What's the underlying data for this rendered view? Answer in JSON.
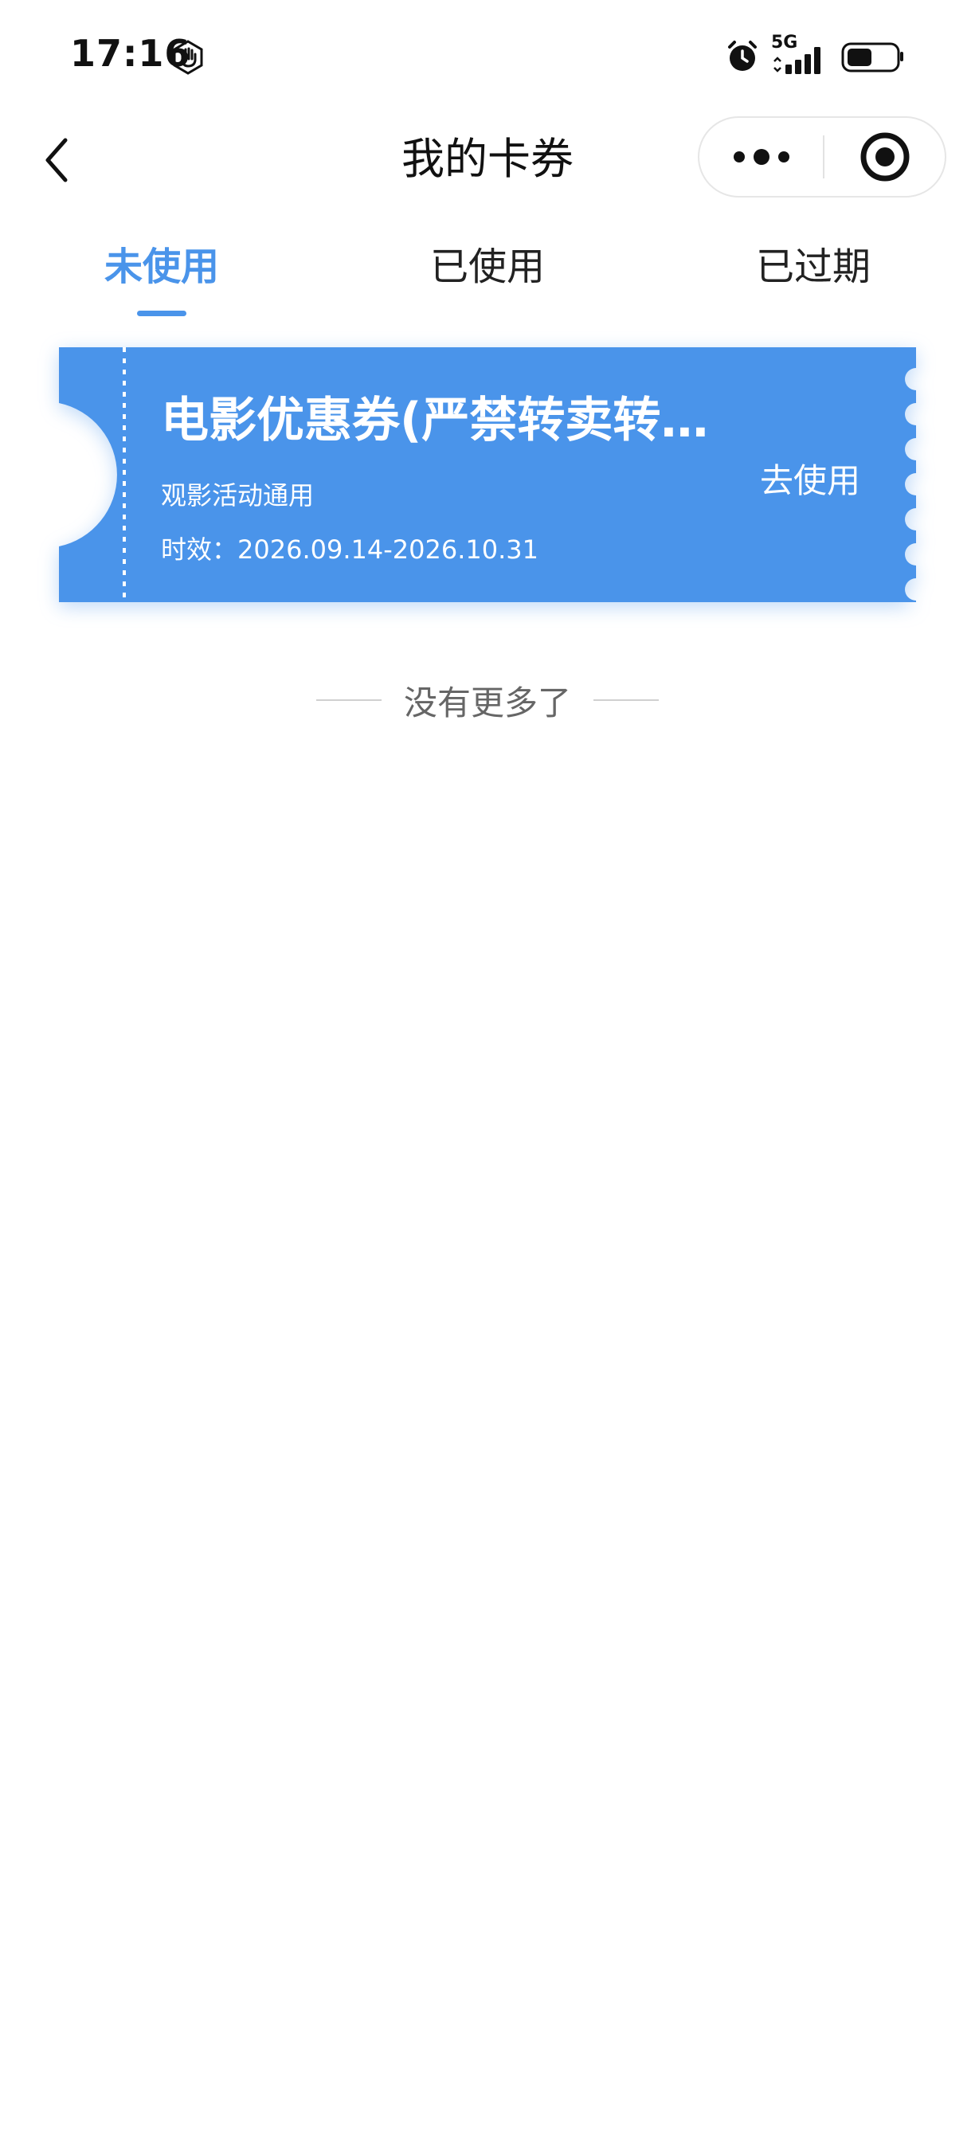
{
  "status_bar": {
    "time": "17:16",
    "network": "5G",
    "icons": [
      "hand-stop-icon",
      "alarm-icon",
      "signal-icon",
      "battery-icon"
    ]
  },
  "nav": {
    "title": "我的卡券",
    "icons": [
      "back-arrow-icon",
      "more-dots-icon",
      "target-close-icon"
    ]
  },
  "tabs": [
    {
      "label": "未使用",
      "active": true
    },
    {
      "label": "已使用",
      "active": false
    },
    {
      "label": "已过期",
      "active": false
    }
  ],
  "coupons": [
    {
      "title": "电影优惠券(严禁转卖转…",
      "subtitle": "观影活动通用",
      "validity": "时效：2026.09.14-2026.10.31",
      "action": "去使用"
    }
  ],
  "list_end_text": "没有更多了",
  "colors": {
    "accent": "#4a94ea",
    "coupon_bg": "#4a94ea",
    "text_primary": "#111111",
    "text_secondary": "#666666"
  }
}
